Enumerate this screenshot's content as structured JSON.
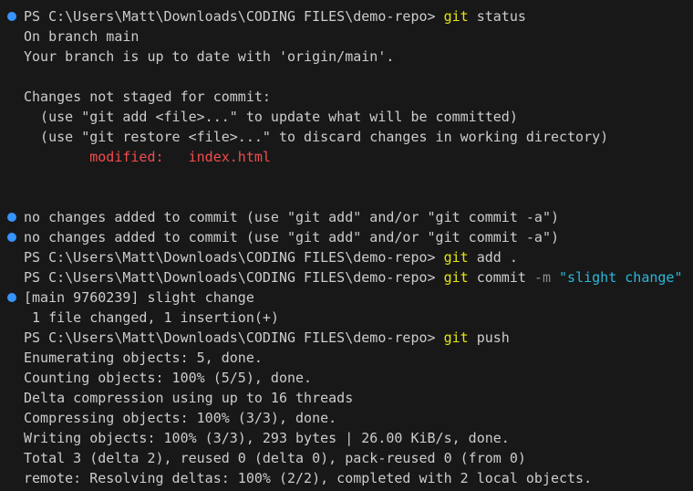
{
  "colors": {
    "background": "#181818",
    "text": "#cccccc",
    "command": "#e5e510",
    "flag": "#8a8a8a",
    "string": "#29b8db",
    "modified": "#f14c4c",
    "decoration": "#3794ff"
  },
  "lines": [
    {
      "dot": true,
      "segments": [
        {
          "t": "PS C:\\Users\\Matt\\Downloads\\CODING FILES\\demo-repo> ",
          "c": "default"
        },
        {
          "t": "git",
          "c": "cmd"
        },
        {
          "t": " status",
          "c": "default"
        }
      ]
    },
    {
      "segments": [
        {
          "t": "On branch main",
          "c": "default"
        }
      ]
    },
    {
      "segments": [
        {
          "t": "Your branch is up to date with 'origin/main'.",
          "c": "default"
        }
      ]
    },
    {
      "segments": []
    },
    {
      "segments": [
        {
          "t": "Changes not staged for commit:",
          "c": "default"
        }
      ]
    },
    {
      "segments": [
        {
          "t": "  (use \"git add <file>...\" to update what will be committed)",
          "c": "default"
        }
      ]
    },
    {
      "segments": [
        {
          "t": "  (use \"git restore <file>...\" to discard changes in working directory)",
          "c": "default"
        }
      ]
    },
    {
      "segments": [
        {
          "t": "        modified:   index.html",
          "c": "red"
        }
      ]
    },
    {
      "segments": []
    },
    {
      "segments": []
    },
    {
      "dot": true,
      "segments": [
        {
          "t": "no changes added to commit (use \"git add\" and/or \"git commit -a\")",
          "c": "default"
        }
      ]
    },
    {
      "dot": true,
      "segments": [
        {
          "t": "no changes added to commit (use \"git add\" and/or \"git commit -a\")",
          "c": "default"
        }
      ]
    },
    {
      "segments": [
        {
          "t": "PS C:\\Users\\Matt\\Downloads\\CODING FILES\\demo-repo> ",
          "c": "default"
        },
        {
          "t": "git",
          "c": "cmd"
        },
        {
          "t": " add .",
          "c": "default"
        }
      ]
    },
    {
      "segments": [
        {
          "t": "PS C:\\Users\\Matt\\Downloads\\CODING FILES\\demo-repo> ",
          "c": "default"
        },
        {
          "t": "git",
          "c": "cmd"
        },
        {
          "t": " commit ",
          "c": "default"
        },
        {
          "t": "-m",
          "c": "flag"
        },
        {
          "t": " ",
          "c": "default"
        },
        {
          "t": "\"slight change\"",
          "c": "string"
        }
      ]
    },
    {
      "dot": true,
      "segments": [
        {
          "t": "[main 9760239] slight change",
          "c": "default"
        }
      ]
    },
    {
      "segments": [
        {
          "t": " 1 file changed, 1 insertion(+)",
          "c": "default"
        }
      ]
    },
    {
      "segments": [
        {
          "t": "PS C:\\Users\\Matt\\Downloads\\CODING FILES\\demo-repo> ",
          "c": "default"
        },
        {
          "t": "git",
          "c": "cmd"
        },
        {
          "t": " push",
          "c": "default"
        }
      ]
    },
    {
      "segments": [
        {
          "t": "Enumerating objects: 5, done.",
          "c": "default"
        }
      ]
    },
    {
      "segments": [
        {
          "t": "Counting objects: 100% (5/5), done.",
          "c": "default"
        }
      ]
    },
    {
      "segments": [
        {
          "t": "Delta compression using up to 16 threads",
          "c": "default"
        }
      ]
    },
    {
      "segments": [
        {
          "t": "Compressing objects: 100% (3/3), done.",
          "c": "default"
        }
      ]
    },
    {
      "segments": [
        {
          "t": "Writing objects: 100% (3/3), 293 bytes | 26.00 KiB/s, done.",
          "c": "default"
        }
      ]
    },
    {
      "segments": [
        {
          "t": "Total 3 (delta 2), reused 0 (delta 0), pack-reused 0 (from 0)",
          "c": "default"
        }
      ]
    },
    {
      "segments": [
        {
          "t": "remote: Resolving deltas: 100% (2/2), completed with 2 local objects.",
          "c": "default"
        }
      ]
    }
  ]
}
